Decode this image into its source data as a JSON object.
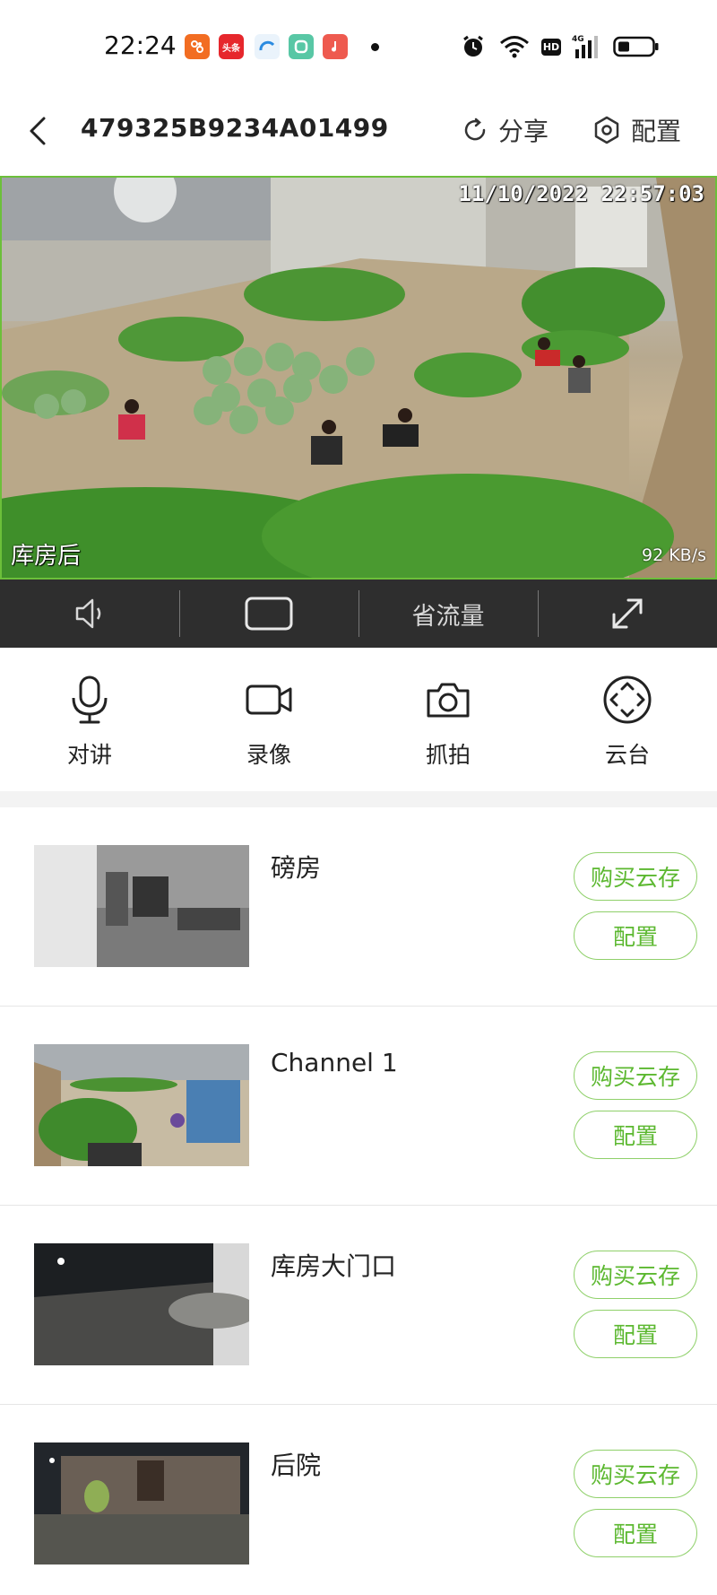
{
  "status_bar": {
    "time": "22:24",
    "apps": [
      "taobao-icon",
      "toutiao-icon",
      "browser-icon",
      "camera-app-icon",
      "music-icon"
    ],
    "toutiao_label": "头条",
    "right_icons": [
      "alarm-icon",
      "wifi-icon",
      "hd-icon",
      "signal-4g-icon",
      "battery-icon"
    ],
    "hd_label": "HD",
    "network_label": "4G"
  },
  "header": {
    "device_id": "479325B9234A01499",
    "share_label": "分享",
    "config_label": "配置"
  },
  "video": {
    "timestamp": "11/10/2022  22:57:03",
    "camera_name": "库房后",
    "bitrate": "92 KB/s"
  },
  "control_bar": {
    "save_traffic_label": "省流量"
  },
  "actions": {
    "talk": "对讲",
    "record": "录像",
    "snapshot": "抓拍",
    "ptz": "云台"
  },
  "channels": [
    {
      "name": "磅房",
      "buy_cloud": "购买云存",
      "config": "配置"
    },
    {
      "name": "Channel 1",
      "buy_cloud": "购买云存",
      "config": "配置"
    },
    {
      "name": "库房大门口",
      "buy_cloud": "购买云存",
      "config": "配置"
    },
    {
      "name": "后院",
      "buy_cloud": "购买云存",
      "config": "配置"
    }
  ],
  "colors": {
    "accent_green": "#5cb830",
    "control_bar_bg": "#2e2e2e"
  }
}
